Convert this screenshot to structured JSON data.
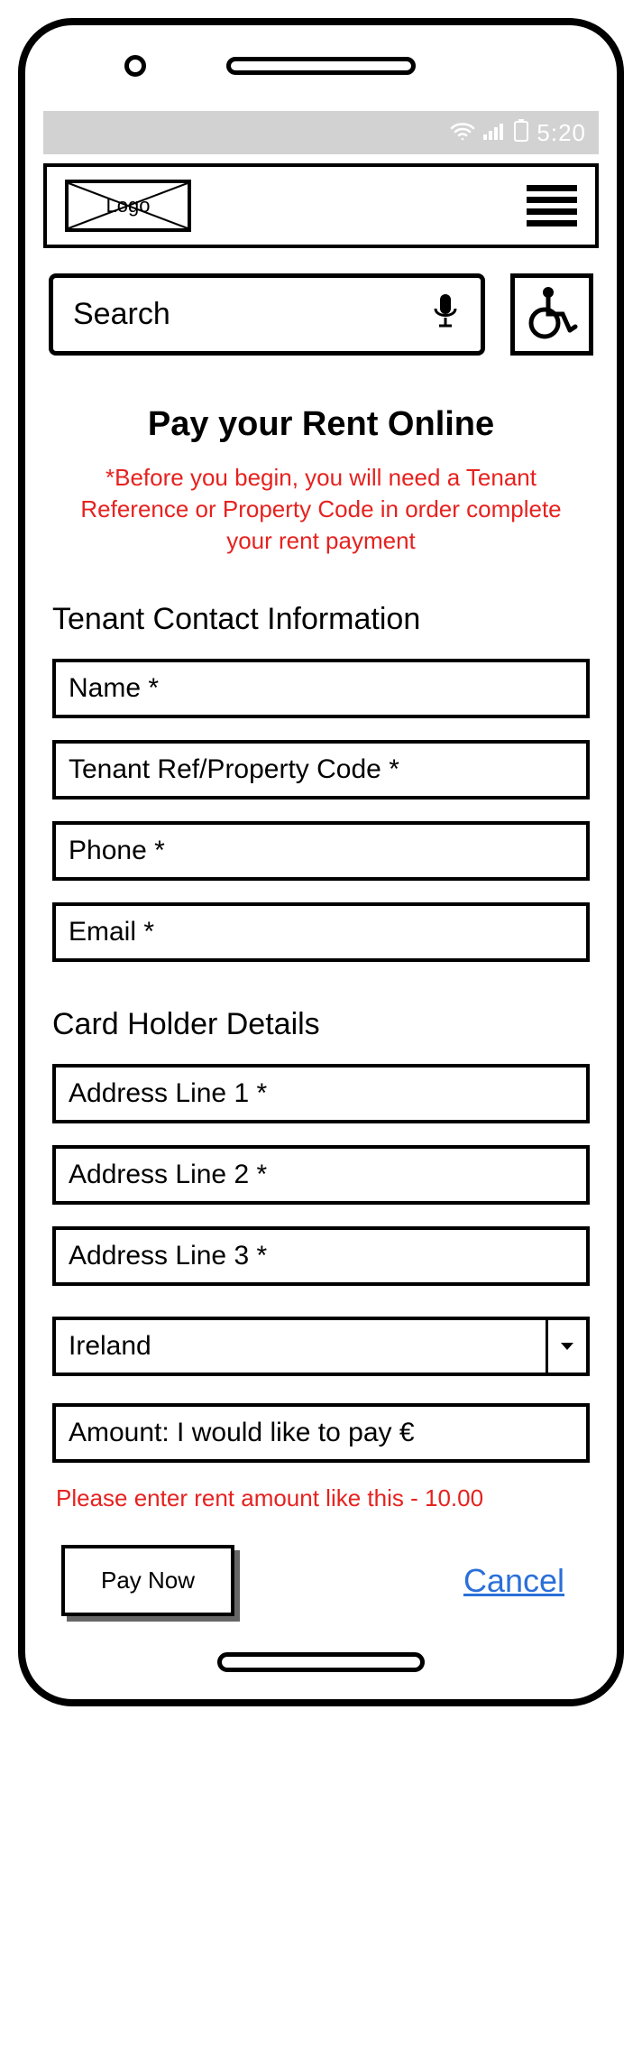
{
  "status": {
    "time": "5:20"
  },
  "header": {
    "logo_text": "Logo"
  },
  "search": {
    "placeholder": "Search"
  },
  "page": {
    "title": "Pay your Rent Online",
    "warning": "*Before you begin, you will need a Tenant Reference or Property Code in order complete your rent payment"
  },
  "tenant": {
    "heading": "Tenant Contact Information",
    "name": "Name *",
    "ref": "Tenant Ref/Property Code *",
    "phone": "Phone *",
    "email": "Email *"
  },
  "card": {
    "heading": "Card Holder Details",
    "addr1": "Address Line 1 *",
    "addr2": "Address Line 2 *",
    "addr3": "Address Line 3 *",
    "country": "Ireland",
    "amount": "Amount: I would like to pay €",
    "hint": "Please enter rent amount like this - 10.00"
  },
  "actions": {
    "pay": "Pay Now",
    "cancel": "Cancel"
  }
}
